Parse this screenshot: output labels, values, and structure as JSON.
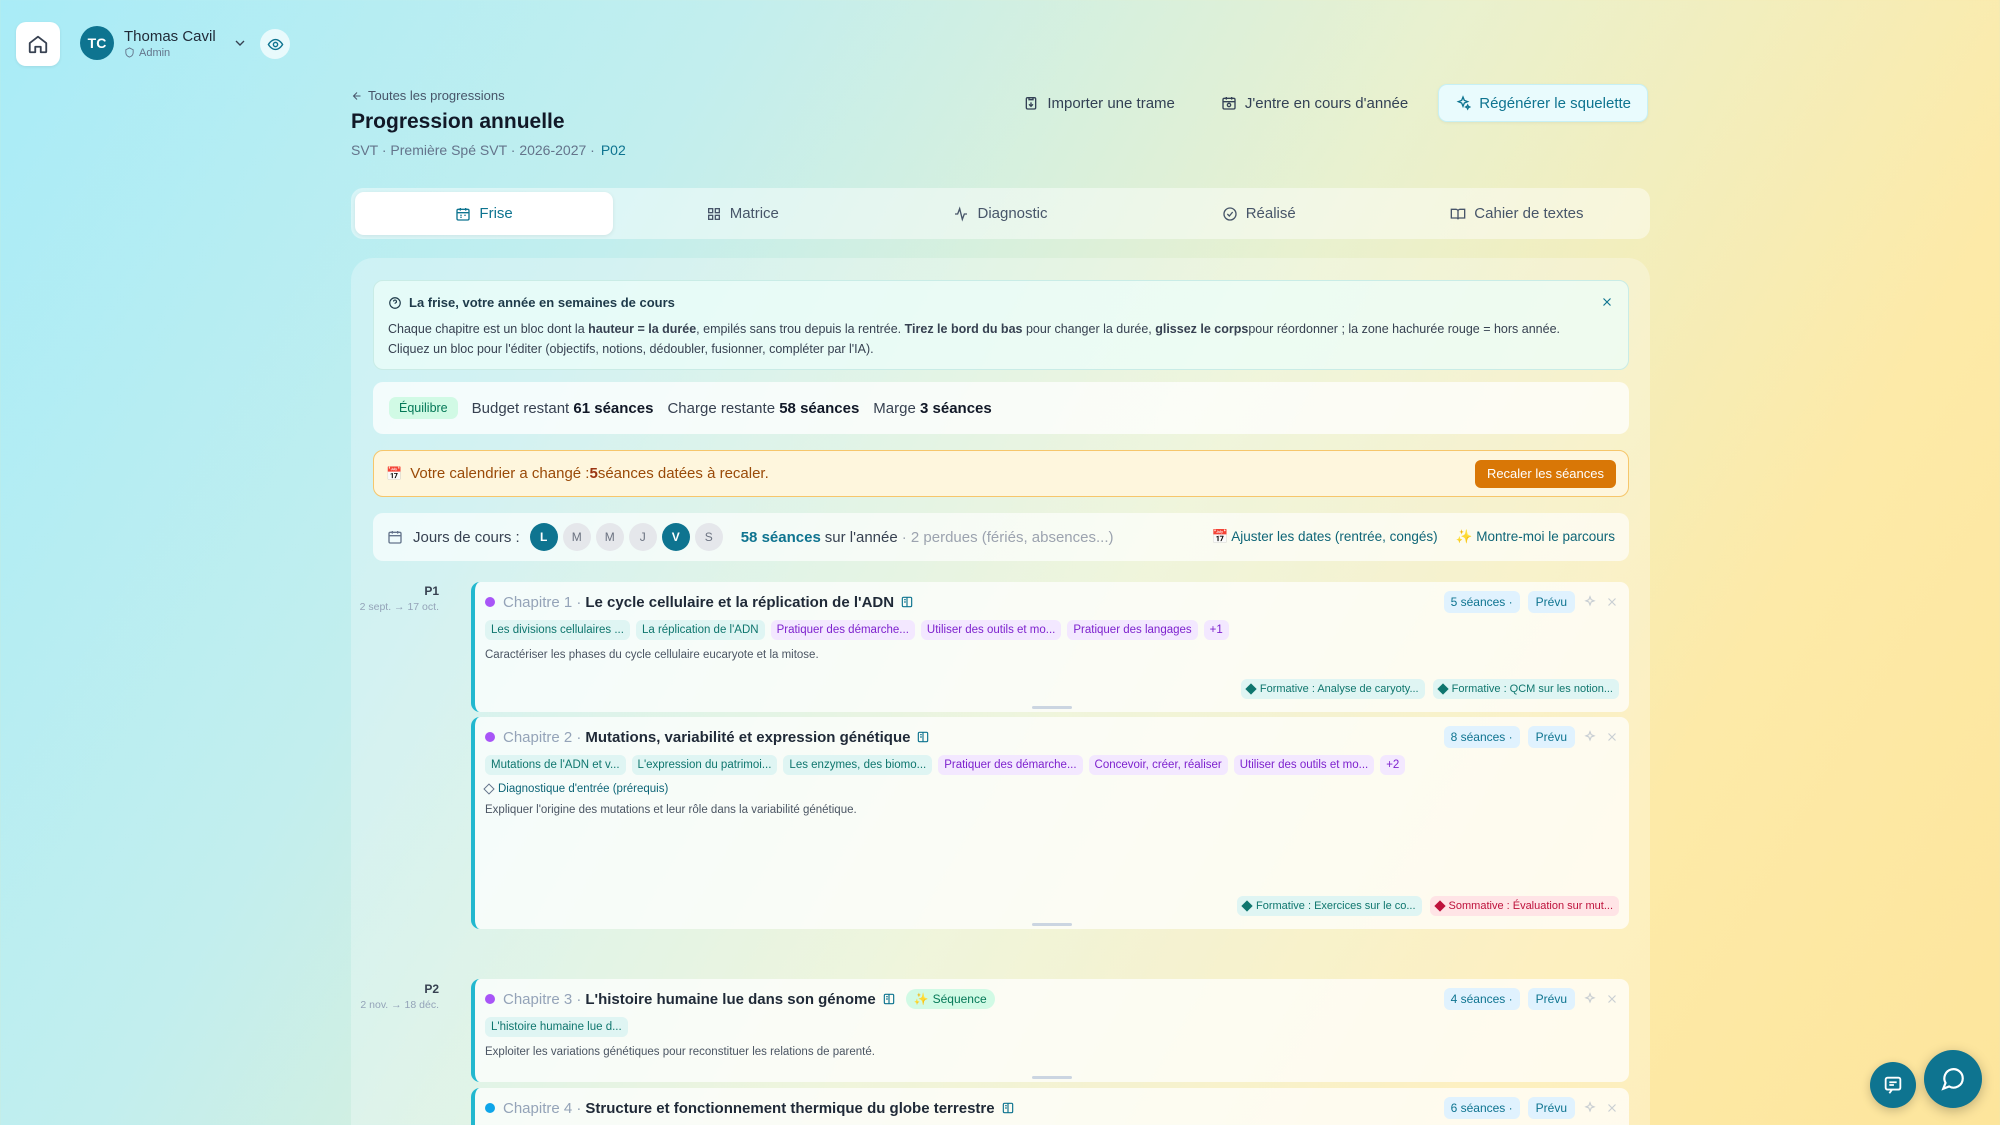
{
  "user": {
    "initials": "TC",
    "name": "Thomas Cavil",
    "role": "Admin"
  },
  "header": {
    "back_link": "Toutes les progressions",
    "title": "Progression annuelle",
    "subtitle": "SVT · Première Spé SVT · 2026-2027 ·",
    "code": "P02"
  },
  "actions": {
    "import": "Importer une trame",
    "enter": "J'entre en cours d'année",
    "regen": "Régénérer le squelette"
  },
  "tabs": [
    {
      "label": "Frise",
      "icon": "calendar-icon"
    },
    {
      "label": "Matrice",
      "icon": "grid-icon"
    },
    {
      "label": "Diagnostic",
      "icon": "activity-icon"
    },
    {
      "label": "Réalisé",
      "icon": "check-circle-icon"
    },
    {
      "label": "Cahier de textes",
      "icon": "book-icon"
    }
  ],
  "info": {
    "title": "La frise, votre année en semaines de cours",
    "t1": "Chaque chapitre est un bloc dont la ",
    "b1": "hauteur = la durée",
    "t2": ", empilés sans trou depuis la rentrée. ",
    "b2": "Tirez le bord du bas",
    "t3": " pour changer la durée, ",
    "b3": "glissez le corps",
    "t4": "pour réordonner ; la zone hachurée rouge = hors année. Cliquez un bloc pour l'éditer (objectifs, notions, dédoubler, fusionner, compléter par l'IA)."
  },
  "budget": {
    "badge": "Équilibre",
    "budget_label": "Budget restant",
    "budget_value": "61 séances",
    "charge_label": "Charge restante",
    "charge_value": "58 séances",
    "marge_label": "Marge",
    "marge_value": "3 séances"
  },
  "alert": {
    "text1": "Votre calendrier a changé : ",
    "count": "5",
    "text2": " séances datées à recaler.",
    "button": "Recaler les séances"
  },
  "days": {
    "label": "Jours de cours :",
    "list": [
      {
        "l": "L",
        "on": true
      },
      {
        "l": "M",
        "on": false
      },
      {
        "l": "M",
        "on": false
      },
      {
        "l": "J",
        "on": false
      },
      {
        "l": "V",
        "on": true
      },
      {
        "l": "S",
        "on": false
      }
    ],
    "count": "58 séances",
    "count_sub": "sur l'année",
    "lost": "· 2 perdues (fériés, absences...)",
    "link1": "Ajuster les dates (rentrée, congés)",
    "link2": "Montre-moi le parcours"
  },
  "periods": [
    {
      "p": "P1",
      "d": "2 sept. → 17 oct."
    },
    {
      "p": "P2",
      "d": "2 nov. → 18 déc."
    }
  ],
  "chapters": [
    {
      "num": "Chapitre 1 ·",
      "title": "Le cycle cellulaire et la réplication de l'ADN",
      "dot": "#a855f7",
      "seances": "5 séances ·",
      "status": "Prévu",
      "tags": [
        {
          "t": "Les divisions cellulaires ...",
          "c": "teal"
        },
        {
          "t": "La réplication de l'ADN",
          "c": "teal"
        },
        {
          "t": "Pratiquer des démarche...",
          "c": "purple"
        },
        {
          "t": "Utiliser des outils et mo...",
          "c": "purple"
        },
        {
          "t": "Pratiquer des langages",
          "c": "purple"
        },
        {
          "t": "+1",
          "c": "more"
        }
      ],
      "desc": "Caractériser les phases du cycle cellulaire eucaryote et la mitose.",
      "evals": [
        {
          "t": "Formative : Analyse de caryoty...",
          "c": "form"
        },
        {
          "t": "Formative : QCM sur les notion...",
          "c": "form"
        }
      ]
    },
    {
      "num": "Chapitre 2 ·",
      "title": "Mutations, variabilité et expression génétique",
      "dot": "#a855f7",
      "seances": "8 séances ·",
      "status": "Prévu",
      "tags": [
        {
          "t": "Mutations de l'ADN et v...",
          "c": "teal"
        },
        {
          "t": "L'expression du patrimoi...",
          "c": "teal"
        },
        {
          "t": "Les enzymes, des biomo...",
          "c": "teal"
        },
        {
          "t": "Pratiquer des démarche...",
          "c": "purple"
        },
        {
          "t": "Concevoir, créer, réaliser",
          "c": "purple"
        },
        {
          "t": "Utiliser des outils et mo...",
          "c": "purple"
        },
        {
          "t": "+2",
          "c": "more"
        }
      ],
      "diag": "Diagnostique d'entrée (prérequis)",
      "desc": "Expliquer l'origine des mutations et leur rôle dans la variabilité génétique.",
      "evals": [
        {
          "t": "Formative : Exercices sur le co...",
          "c": "form"
        },
        {
          "t": "Sommative : Évaluation sur mut...",
          "c": "somm"
        }
      ]
    },
    {
      "num": "Chapitre 3 ·",
      "title": "L'histoire humaine lue dans son génome",
      "dot": "#a855f7",
      "seq": "Séquence",
      "seances": "4 séances ·",
      "status": "Prévu",
      "tags": [
        {
          "t": "L'histoire humaine lue d...",
          "c": "teal"
        }
      ],
      "desc": "Exploiter les variations génétiques pour reconstituer les relations de parenté."
    },
    {
      "num": "Chapitre 4 ·",
      "title": "Structure et fonctionnement thermique du globe terrestre",
      "dot": "#0ea5e9",
      "seances": "6 séances ·",
      "status": "Prévu"
    }
  ],
  "colors": {
    "accent": "#0e7490",
    "warning": "#d97706",
    "alert_bg": "#fef6dd"
  }
}
